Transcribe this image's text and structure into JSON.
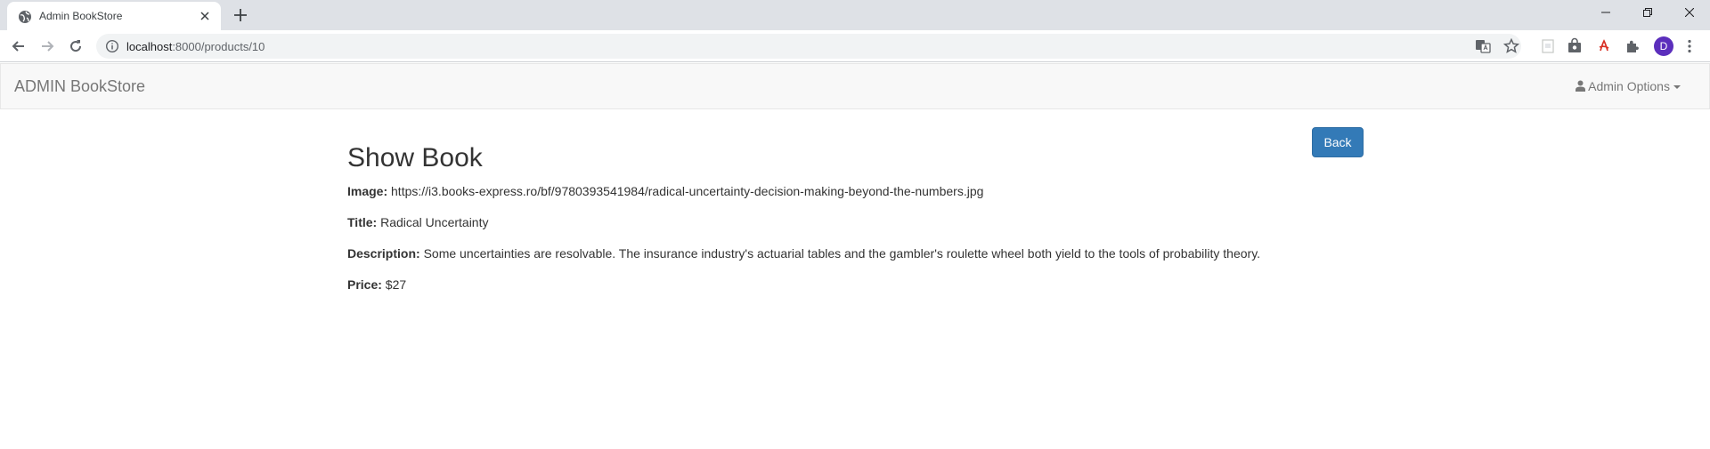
{
  "browser": {
    "tab_title": "Admin BookStore",
    "url_host": "localhost",
    "url_path": ":8000/products/10",
    "profile_initial": "D"
  },
  "navbar": {
    "brand": "ADMIN BookStore",
    "admin_options": "Admin Options"
  },
  "page": {
    "title": "Show Book",
    "back_label": "Back"
  },
  "book": {
    "image_label": "Image:",
    "image_value": " https://i3.books-express.ro/bf/9780393541984/radical-uncertainty-decision-making-beyond-the-numbers.jpg",
    "title_label": "Title:",
    "title_value": " Radical Uncertainty",
    "description_label": "Description:",
    "description_value": " Some uncertainties are resolvable. The insurance industry's actuarial tables and the gambler's roulette wheel both yield to the tools of probability theory.",
    "price_label": "Price:",
    "price_value": " $27"
  },
  "colors": {
    "primary": "#337ab7",
    "navbar_bg": "#f8f8f8",
    "avatar": "#5b2ebc"
  }
}
